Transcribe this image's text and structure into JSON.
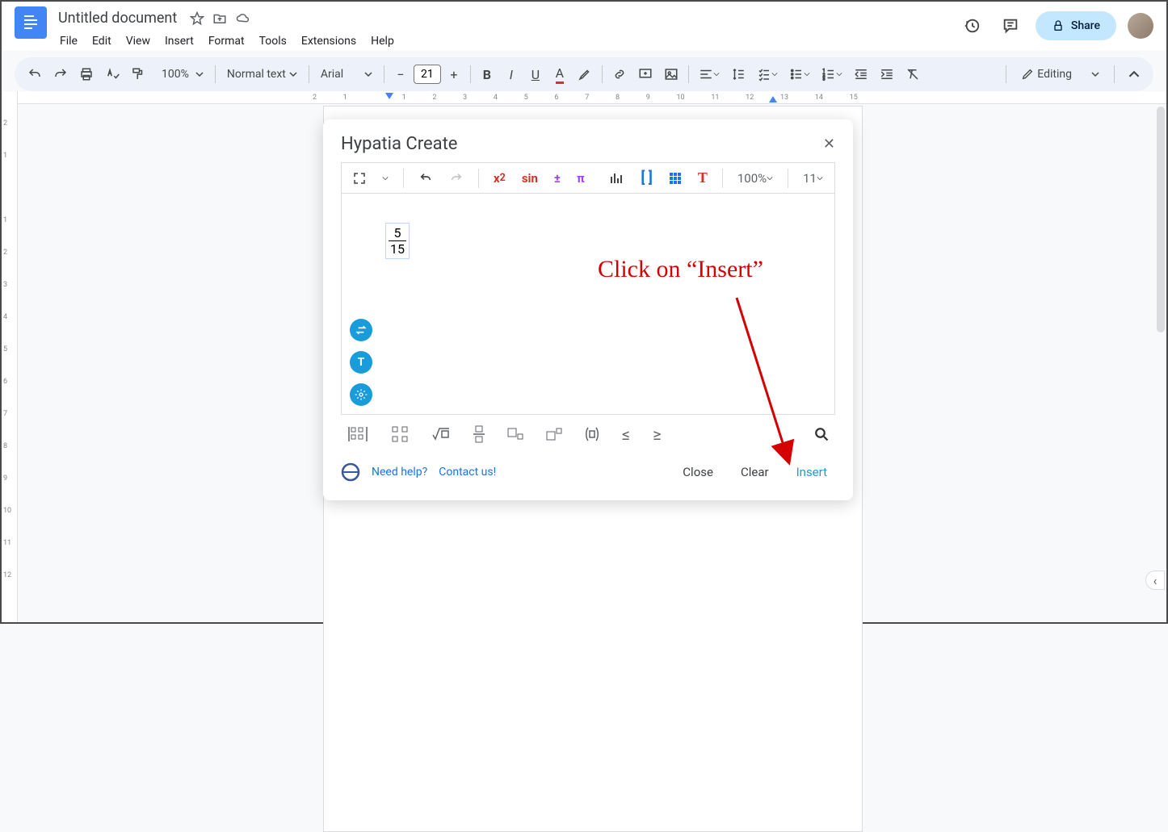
{
  "doc": {
    "title": "Untitled document"
  },
  "menus": [
    "File",
    "Edit",
    "View",
    "Insert",
    "Format",
    "Tools",
    "Extensions",
    "Help"
  ],
  "share": {
    "label": "Share"
  },
  "toolbar": {
    "zoom": "100%",
    "style": "Normal text",
    "font": "Arial",
    "fontSize": "21",
    "editing": "Editing"
  },
  "hruler": [
    "2",
    "",
    "1",
    "",
    "",
    "1",
    "",
    "2",
    "",
    "3",
    "",
    "4",
    "",
    "5",
    "",
    "6",
    "",
    "7",
    "",
    "8",
    "",
    "9",
    "",
    "10",
    "",
    "1"
  ],
  "hruler_numbers": [
    "2",
    "1",
    "1",
    "2",
    "3",
    "4",
    "5",
    "6",
    "7",
    "8",
    "9",
    "10",
    "1"
  ],
  "vruler": [
    "2",
    "1",
    "1",
    "2",
    "3",
    "4",
    "5",
    "6",
    "7",
    "8",
    "9",
    "10",
    "11",
    "12"
  ],
  "dialog": {
    "title": "Hypatia Create",
    "zoom": "100%",
    "fontSize": "11",
    "fraction": {
      "num": "5",
      "den": "15"
    },
    "help": "Need help?",
    "contact": "Contact us!",
    "close": "Close",
    "clear": "Clear",
    "insert": "Insert"
  },
  "annotation": {
    "text": "Click on “Insert”"
  },
  "ruler_marks": [
    "2",
    "1",
    "1",
    "2",
    "3",
    "4",
    "5",
    "6",
    "7",
    "8",
    "9",
    "10",
    "11",
    "12",
    "13",
    "14",
    "15"
  ]
}
